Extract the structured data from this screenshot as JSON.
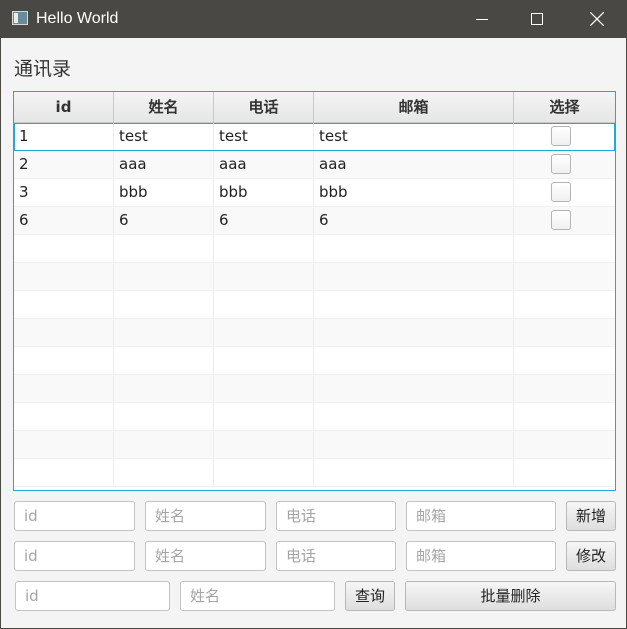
{
  "window": {
    "title": "Hello World",
    "icon": "app-window-icon",
    "controls": [
      "minimize-icon",
      "maximize-icon",
      "close-icon"
    ]
  },
  "heading": "通讯录",
  "table": {
    "columns": [
      "id",
      "姓名",
      "电话",
      "邮箱",
      "选择"
    ],
    "rows": [
      {
        "id": "1",
        "name": "test",
        "phone": "test",
        "email": "test",
        "selected": false
      },
      {
        "id": "2",
        "name": "aaa",
        "phone": "aaa",
        "email": "aaa",
        "selected": false
      },
      {
        "id": "3",
        "name": "bbb",
        "phone": "bbb",
        "email": "bbb",
        "selected": false
      },
      {
        "id": "6",
        "name": "6",
        "phone": "6",
        "email": "6",
        "selected": false
      }
    ]
  },
  "add_form": {
    "id_placeholder": "id",
    "name_placeholder": "姓名",
    "phone_placeholder": "电话",
    "email_placeholder": "邮箱",
    "button": "新增"
  },
  "edit_form": {
    "id_placeholder": "id",
    "name_placeholder": "姓名",
    "phone_placeholder": "电话",
    "email_placeholder": "邮箱",
    "button": "修改"
  },
  "query_form": {
    "id_placeholder": "id",
    "name_placeholder": "姓名",
    "query_button": "查询",
    "batch_delete_button": "批量删除"
  },
  "colors": {
    "titlebar": "#4a4845",
    "table_border": "#1fa8d8",
    "background": "#f4f4f4"
  }
}
